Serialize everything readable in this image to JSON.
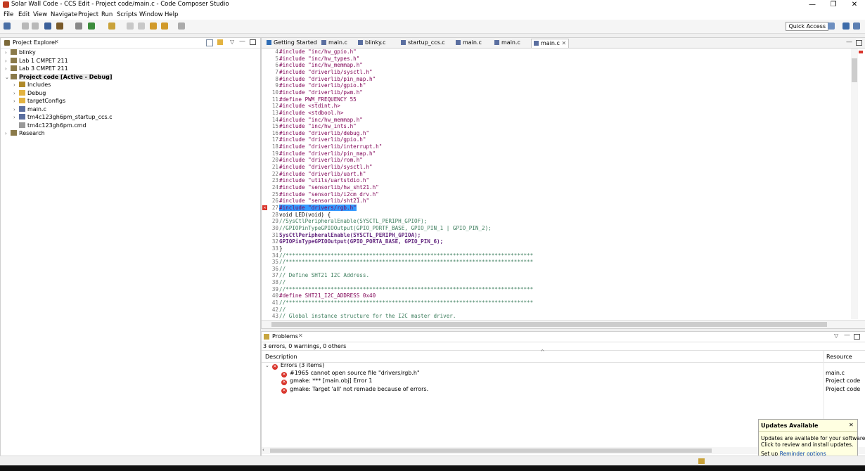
{
  "window": {
    "title": "Solar Wall Code - CCS Edit - Project code/main.c - Code Composer Studio",
    "minimize": "—",
    "restore": "❐",
    "close": "✕"
  },
  "menu": [
    "File",
    "Edit",
    "View",
    "Navigate",
    "Project",
    "Run",
    "Scripts",
    "Window",
    "Help"
  ],
  "toolbar": {
    "quick_access": "Quick Access"
  },
  "explorer": {
    "title": "Project Explorer",
    "items": [
      {
        "label": "blinky",
        "indent": 0,
        "twist": "›",
        "icon": "project-icon"
      },
      {
        "label": "Lab 1 CMPET 211",
        "indent": 0,
        "twist": "›",
        "icon": "project-icon"
      },
      {
        "label": "Lab 3 CMPET 211",
        "indent": 0,
        "twist": "›",
        "icon": "project-icon"
      },
      {
        "label": "Project code  [Active - Debug]",
        "indent": 0,
        "twist": "⌄",
        "icon": "project-icon",
        "bold": true
      },
      {
        "label": "Includes",
        "indent": 1,
        "twist": "›",
        "icon": "includes-icon"
      },
      {
        "label": "Debug",
        "indent": 1,
        "twist": "›",
        "icon": "folder-icon"
      },
      {
        "label": "targetConfigs",
        "indent": 1,
        "twist": "›",
        "icon": "folder-icon"
      },
      {
        "label": "main.c",
        "indent": 1,
        "twist": "›",
        "icon": "c-file-icon"
      },
      {
        "label": "tm4c123gh6pm_startup_ccs.c",
        "indent": 1,
        "twist": "›",
        "icon": "c-file-icon"
      },
      {
        "label": "tm4c123gh6pm.cmd",
        "indent": 1,
        "twist": "",
        "icon": "cmd-file-icon"
      },
      {
        "label": "Research",
        "indent": 0,
        "twist": "›",
        "icon": "project-icon"
      }
    ]
  },
  "editor": {
    "tabs": [
      "Getting Started",
      "main.c",
      "blinky.c",
      "startup_ccs.c",
      "main.c",
      "main.c",
      "main.c"
    ],
    "active_tab": 6,
    "lines": [
      {
        "n": "4",
        "t": "#include \"inc/hw_gpio.h\"",
        "k": "inc"
      },
      {
        "n": "5",
        "t": "#include \"inc/hw_types.h\"",
        "k": "inc"
      },
      {
        "n": "6",
        "t": "#include \"inc/hw_memmap.h\"",
        "k": "inc"
      },
      {
        "n": "7",
        "t": "#include \"driverlib/sysctl.h\"",
        "k": "inc"
      },
      {
        "n": "8",
        "t": "#include \"driverlib/pin_map.h\"",
        "k": "inc"
      },
      {
        "n": "9",
        "t": "#include \"driverlib/gpio.h\"",
        "k": "inc"
      },
      {
        "n": "10",
        "t": "#include \"driverlib/pwm.h\"",
        "k": "inc"
      },
      {
        "n": "11",
        "t": "#define PWM_FREQUENCY 55",
        "k": "def"
      },
      {
        "n": "12",
        "t": "#include <stdint.h>",
        "k": "inc"
      },
      {
        "n": "13",
        "t": "#include <stdbool.h>",
        "k": "inc"
      },
      {
        "n": "14",
        "t": "#include \"inc/hw_memmap.h\"",
        "k": "inc"
      },
      {
        "n": "15",
        "t": "#include \"inc/hw_ints.h\"",
        "k": "inc"
      },
      {
        "n": "16",
        "t": "#include \"driverlib/debug.h\"",
        "k": "inc"
      },
      {
        "n": "17",
        "t": "#include \"driverlib/gpio.h\"",
        "k": "inc"
      },
      {
        "n": "18",
        "t": "#include \"driverlib/interrupt.h\"",
        "k": "inc"
      },
      {
        "n": "19",
        "t": "#include \"driverlib/pin_map.h\"",
        "k": "inc"
      },
      {
        "n": "20",
        "t": "#include \"driverlib/rom.h\"",
        "k": "inc"
      },
      {
        "n": "21",
        "t": "#include \"driverlib/sysctl.h\"",
        "k": "inc"
      },
      {
        "n": "22",
        "t": "#include \"driverlib/uart.h\"",
        "k": "inc"
      },
      {
        "n": "23",
        "t": "#include \"utils/uartstdio.h\"",
        "k": "inc"
      },
      {
        "n": "24",
        "t": "#include \"sensorlib/hw_sht21.h\"",
        "k": "inc"
      },
      {
        "n": "25",
        "t": "#include \"sensorlib/i2cm_drv.h\"",
        "k": "inc"
      },
      {
        "n": "26",
        "t": "#include \"sensorlib/sht21.h\"",
        "k": "inc"
      },
      {
        "n": "27",
        "t": "#include \"drivers/rgb.h\"",
        "k": "inc",
        "hl": true,
        "err": true
      },
      {
        "n": "28",
        "t": "void LED(void) {",
        "k": "void"
      },
      {
        "n": "29",
        "t": "//SysCtlPeripheralEnable(SYSCTL_PERIPH_GPIOF);",
        "k": "cm"
      },
      {
        "n": "30",
        "t": "//GPIOPinTypeGPIOOutput(GPIO_PORTF_BASE, GPIO_PIN_1 | GPIO_PIN_2);",
        "k": "cm"
      },
      {
        "n": "31",
        "t": "SysCtlPeripheralEnable(SYSCTL_PERIPH_GPIOA);",
        "k": "fn"
      },
      {
        "n": "32",
        "t": "GPIOPinTypeGPIOOutput(GPIO_PORTA_BASE, GPIO_PIN_6);",
        "k": "fn"
      },
      {
        "n": "33",
        "t": "}",
        "k": "plain"
      },
      {
        "n": "34",
        "t": "//*****************************************************************************",
        "k": "cm"
      },
      {
        "n": "35",
        "t": "//*****************************************************************************",
        "k": "cm"
      },
      {
        "n": "36",
        "t": "//",
        "k": "cm"
      },
      {
        "n": "37",
        "t": "// Define SHT21 I2C Address.",
        "k": "cm"
      },
      {
        "n": "38",
        "t": "//",
        "k": "cm"
      },
      {
        "n": "39",
        "t": "//*****************************************************************************",
        "k": "cm"
      },
      {
        "n": "40",
        "t": "#define SHT21_I2C_ADDRESS 0x40",
        "k": "def"
      },
      {
        "n": "41",
        "t": "//*****************************************************************************",
        "k": "cm"
      },
      {
        "n": "42",
        "t": "//",
        "k": "cm"
      },
      {
        "n": "43",
        "t": "// Global instance structure for the I2C master driver.",
        "k": "cm"
      }
    ]
  },
  "problems": {
    "title": "Problems",
    "summary": "3 errors, 0 warnings, 0 others",
    "col_description": "Description",
    "col_resource": "Resource",
    "group": "Errors (3 items)",
    "rows": [
      {
        "desc": "#1965 cannot open source file \"drivers/rgb.h\"",
        "res": "main.c"
      },
      {
        "desc": "gmake: *** [main.obj] Error 1",
        "res": "Project code"
      },
      {
        "desc": "gmake: Target 'all' not remade because of errors.",
        "res": "Project code"
      }
    ]
  },
  "popup": {
    "title": "Updates Available",
    "body1": "Updates are available for your software.",
    "body2": "Click to review and install updates.",
    "setup_prefix": "Set up ",
    "link": "Reminder options",
    "close": "✕"
  },
  "colors": {
    "accent": "#3399ff",
    "error": "#d9342b",
    "keyword": "#7f0055",
    "string": "#2a00ff",
    "comment": "#3f7f5f"
  }
}
